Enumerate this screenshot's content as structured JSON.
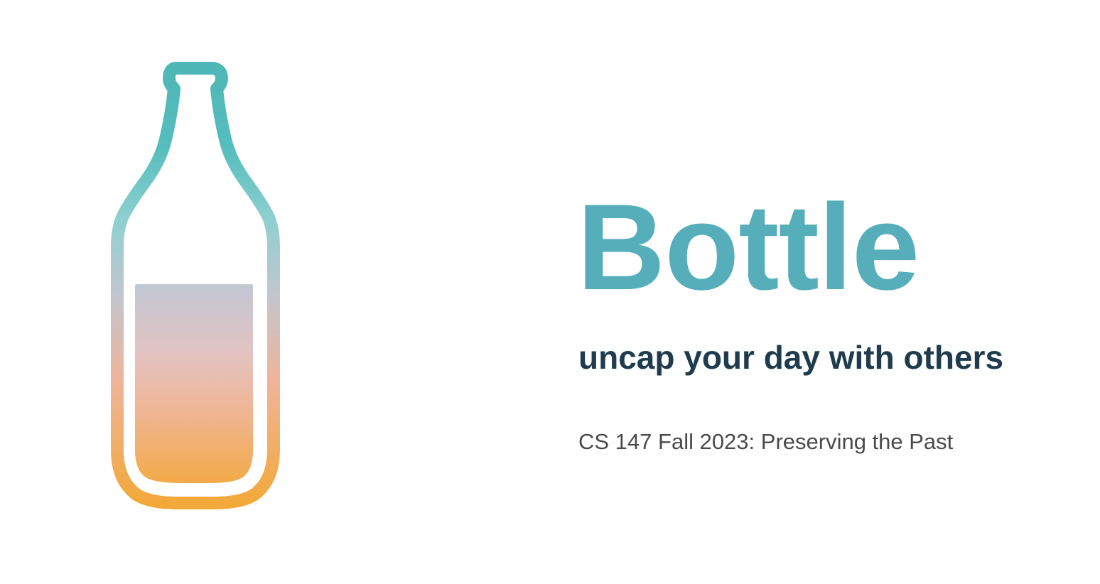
{
  "brand": {
    "title": "Bottle",
    "tagline": "uncap your day with others",
    "course": "CS 147 Fall 2023: Preserving the Past",
    "logo_icon": "bottle-icon"
  },
  "colors": {
    "title": "#57aebb",
    "tagline": "#1f3b4d",
    "course": "#4a4a4a",
    "bottle_top": "#4fb8b7",
    "bottle_mid": "#9fd3d6",
    "bottle_bottom": "#f3a93e",
    "liquid_top": "#c2c7d4",
    "liquid_mid": "#eeb495",
    "liquid_bottom": "#f2aa4a",
    "background": "#ffffff"
  }
}
